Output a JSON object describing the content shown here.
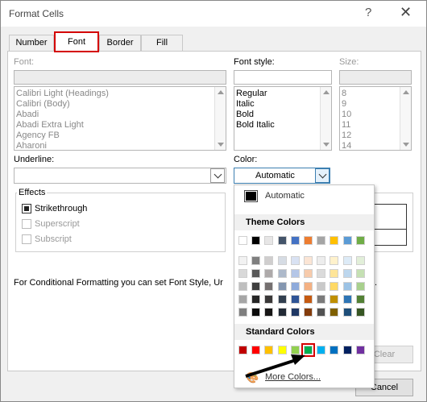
{
  "window": {
    "title": "Format Cells",
    "help": "?",
    "close": "✕"
  },
  "tabs": [
    {
      "label": "Number"
    },
    {
      "label": "Font"
    },
    {
      "label": "Border"
    },
    {
      "label": "Fill"
    }
  ],
  "font": {
    "label": "Font:",
    "value": "",
    "items": [
      "Calibri Light (Headings)",
      "Calibri (Body)",
      "Abadi",
      "Abadi Extra Light",
      "Agency FB",
      "Aharoni"
    ]
  },
  "font_style": {
    "label": "Font style:",
    "value": "",
    "items": [
      "Regular",
      "Italic",
      "Bold",
      "Bold Italic"
    ]
  },
  "size": {
    "label": "Size:",
    "value": "",
    "items": [
      "8",
      "9",
      "10",
      "11",
      "12",
      "14"
    ]
  },
  "underline": {
    "label": "Underline:",
    "value": ""
  },
  "color": {
    "label": "Color:",
    "value": "Automatic"
  },
  "effects": {
    "title": "Effects",
    "strikethrough": "Strikethrough",
    "superscript": "Superscript",
    "subscript": "Subscript"
  },
  "info_text": "For Conditional Formatting you can set Font Style, Ur",
  "buttons": {
    "clear": "Clear",
    "cancel": "Cancel"
  },
  "picker": {
    "automatic": "Automatic",
    "theme_title": "Theme Colors",
    "standard_title": "Standard Colors",
    "more_colors": "More Colors...",
    "theme_top": [
      "#ffffff",
      "#000000",
      "#e7e6e6",
      "#44546a",
      "#4472c4",
      "#ed7d31",
      "#a5a5a5",
      "#ffc000",
      "#5b9bd5",
      "#70ad47"
    ],
    "theme_shades": [
      [
        "#f2f2f2",
        "#7f7f7f",
        "#d0cece",
        "#d6dce4",
        "#d9e2f3",
        "#fbe5d5",
        "#ededed",
        "#fff2cc",
        "#ddebf7",
        "#e2efd9"
      ],
      [
        "#d9d9d9",
        "#595959",
        "#aeaaaa",
        "#adb9ca",
        "#b4c6e7",
        "#f7cbac",
        "#dbdbdb",
        "#fee599",
        "#bdd7ee",
        "#c5e0b3"
      ],
      [
        "#bfbfbf",
        "#3f3f3f",
        "#757070",
        "#8496b0",
        "#8eaadb",
        "#f4b183",
        "#c9c9c9",
        "#ffd965",
        "#9cc3e5",
        "#a8d08d"
      ],
      [
        "#a6a6a6",
        "#262626",
        "#3a3838",
        "#323f4f",
        "#2f5496",
        "#c55a11",
        "#7b7b7b",
        "#bf8f00",
        "#2e75b5",
        "#538135"
      ],
      [
        "#7f7f7f",
        "#0c0c0c",
        "#171616",
        "#222a35",
        "#1f3864",
        "#833c0b",
        "#525252",
        "#7f6000",
        "#1e4e79",
        "#375623"
      ]
    ],
    "standard": [
      "#c00000",
      "#ff0000",
      "#ffc000",
      "#ffff00",
      "#92d050",
      "#00b050",
      "#00b0f0",
      "#0070c0",
      "#002060",
      "#7030a0"
    ],
    "selected_standard_index": 5
  }
}
